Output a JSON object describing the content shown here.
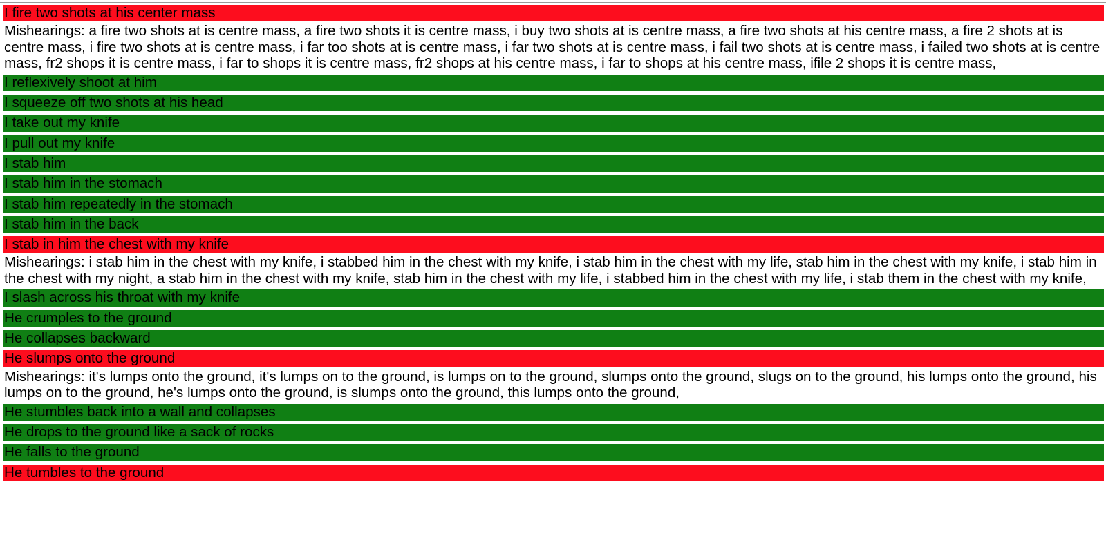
{
  "colors": {
    "correct": "#107f14",
    "error": "#fd0d1e",
    "background": "#ffffff",
    "text": "#000000"
  },
  "mishearings_prefix": "Mishearings: ",
  "entries": [
    {
      "text": "I fire two shots at his center mass",
      "status": "error",
      "mishearings": "a fire two shots at is centre mass, a fire two shots it is centre mass, i buy two shots at is centre mass, a fire two shots at his centre mass, a fire 2 shots at is centre mass, i fire two shots at is centre mass, i far too shots at is centre mass, i far two shots at is centre mass, i fail two shots at is centre mass, i failed two shots at is centre mass, fr2 shops it is centre mass, i far to shops it is centre mass, fr2 shops at his centre mass, i far to shops at his centre mass, ifile 2 shops it is centre mass,"
    },
    {
      "text": "I reflexively shoot at him",
      "status": "correct"
    },
    {
      "text": "I squeeze off two shots at his head",
      "status": "correct"
    },
    {
      "text": "I take out my knife",
      "status": "correct"
    },
    {
      "text": "I pull out my knife",
      "status": "correct"
    },
    {
      "text": "I stab him",
      "status": "correct"
    },
    {
      "text": "I stab him in the stomach",
      "status": "correct"
    },
    {
      "text": "I stab him repeatedly in the stomach",
      "status": "correct"
    },
    {
      "text": "I stab him in the back",
      "status": "correct"
    },
    {
      "text": "I stab in him the chest with my knife",
      "status": "error",
      "mishearings": "i stab him in the chest with my knife, i stabbed him in the chest with my knife, i stab him in the chest with my life, stab him in the chest with my knife, i stab him in the chest with my night, a stab him in the chest with my knife, stab him in the chest with my life, i stabbed him in the chest with my life, i stab them in the chest with my knife,"
    },
    {
      "text": "I slash across his throat with my knife",
      "status": "correct"
    },
    {
      "text": "He crumples to the ground",
      "status": "correct"
    },
    {
      "text": "He collapses backward",
      "status": "correct"
    },
    {
      "text": "He slumps onto the ground",
      "status": "error",
      "mishearings": "it's lumps onto the ground, it's lumps on to the ground, is lumps on to the ground, slumps onto the ground, slugs on to the ground, his lumps onto the ground, his lumps on to the ground, he's lumps onto the ground, is slumps onto the ground, this lumps onto the ground,"
    },
    {
      "text": "He stumbles back into a wall and collapses",
      "status": "correct"
    },
    {
      "text": "He drops to the ground like a sack of rocks",
      "status": "correct"
    },
    {
      "text": "He falls to the ground",
      "status": "correct"
    },
    {
      "text": "He tumbles to the ground",
      "status": "error"
    }
  ]
}
